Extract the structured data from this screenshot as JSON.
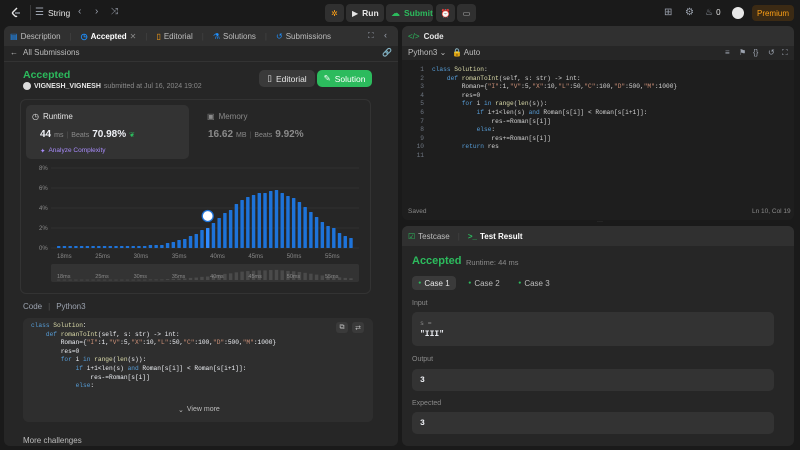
{
  "topbar": {
    "problem_list_label": "String",
    "run_label": "Run",
    "submit_label": "Submit",
    "streak_count": "0",
    "premium_label": "Premium"
  },
  "left_tabs": {
    "description": "Description",
    "accepted": "Accepted",
    "editorial": "Editorial",
    "solutions": "Solutions",
    "submissions": "Submissions"
  },
  "submission": {
    "back_label": "All Submissions",
    "status": "Accepted",
    "user": "VIGNESH_VIGNESH",
    "submitted_text": "submitted at Jul 16, 2024 19:02",
    "editorial_btn": "Editorial",
    "solution_btn": "Solution",
    "runtime_label": "Runtime",
    "runtime_value": "44",
    "runtime_unit": "ms",
    "beats_label": "Beats",
    "runtime_beats": "70.98%",
    "analyze_label": "Analyze Complexity",
    "memory_label": "Memory",
    "memory_value": "16.62",
    "memory_unit": "MB",
    "memory_beats": "9.92%",
    "code_label": "Code",
    "language": "Python3",
    "view_more": "View more",
    "more_challenges": "More challenges"
  },
  "chart_data": {
    "type": "bar",
    "y_ticks": [
      "8%",
      "6%",
      "4%",
      "2%",
      "0%"
    ],
    "ylim": [
      0,
      8
    ],
    "x_ticks": [
      "18ms",
      "25ms",
      "30ms",
      "35ms",
      "40ms",
      "45ms",
      "50ms",
      "55ms"
    ],
    "values": [
      0.2,
      0.2,
      0.2,
      0.2,
      0.2,
      0.2,
      0.2,
      0.2,
      0.2,
      0.2,
      0.2,
      0.2,
      0.2,
      0.2,
      0.2,
      0.2,
      0.3,
      0.3,
      0.3,
      0.5,
      0.6,
      0.8,
      0.9,
      1.2,
      1.4,
      1.8,
      2.0,
      2.5,
      3.0,
      3.5,
      3.8,
      4.4,
      4.8,
      5.1,
      5.3,
      5.5,
      5.5,
      5.7,
      5.8,
      5.5,
      5.2,
      5.0,
      4.6,
      4.1,
      3.6,
      3.1,
      2.6,
      2.2,
      2.0,
      1.5,
      1.2,
      1.0
    ],
    "highlight_index": 26,
    "minimap_ticks": [
      "18ms",
      "25ms",
      "30ms",
      "35ms",
      "40ms",
      "45ms",
      "50ms",
      "55ms"
    ]
  },
  "left_code": [
    [
      [
        "kw",
        "class "
      ],
      [
        "fn",
        "Solution"
      ],
      [
        "",
        "："
      ]
    ],
    [
      [
        "",
        "    "
      ],
      [
        "kw",
        "def "
      ],
      [
        "fn",
        "romanToInt"
      ],
      [
        "",
        "(self, s: str) -> int:"
      ]
    ],
    [
      [
        "",
        "        Roman={"
      ],
      [
        "str",
        "\"I\""
      ],
      [
        "",
        ":1,"
      ],
      [
        "str",
        "\"V\""
      ],
      [
        "",
        ":5,"
      ],
      [
        "str",
        "\"X\""
      ],
      [
        "",
        ":10,"
      ],
      [
        "str",
        "\"L\""
      ],
      [
        "",
        ":50,"
      ],
      [
        "str",
        "\"C\""
      ],
      [
        "",
        ":100,"
      ],
      [
        "str",
        "\"D\""
      ],
      [
        "",
        ":500,"
      ],
      [
        "str",
        "\"M\""
      ],
      [
        "",
        ":1000}"
      ]
    ],
    [
      [
        "",
        "        res=0"
      ]
    ],
    [
      [
        "",
        "        "
      ],
      [
        "kw",
        "for "
      ],
      [
        "",
        "i "
      ],
      [
        "kw",
        "in "
      ],
      [
        "fn",
        "range"
      ],
      [
        "",
        "("
      ],
      [
        "fn",
        "len"
      ],
      [
        "",
        "(s)):"
      ]
    ],
    [
      [
        "",
        "            "
      ],
      [
        "kw",
        "if "
      ],
      [
        "",
        "i+1<len(s) "
      ],
      [
        "kw",
        "and "
      ],
      [
        "",
        "Roman[s[i]] < Roman[s[i+1]]:"
      ]
    ],
    [
      [
        "",
        "                res-=Roman[s[i]]"
      ]
    ],
    [
      [
        "",
        "            "
      ],
      [
        "kw",
        "else"
      ],
      [
        "",
        ":"
      ]
    ]
  ],
  "right_code": {
    "tab_label": "Code",
    "language": "Python3",
    "auto_label": "Auto",
    "saved_label": "Saved",
    "cursor_pos": "Ln 10, Col 19",
    "line_numbers": [
      "1",
      "2",
      "3",
      "4",
      "5",
      "6",
      "7",
      "8",
      "9",
      "10",
      "11"
    ],
    "lines": [
      [
        [
          "kw",
          "class "
        ],
        [
          "fn",
          "Solution"
        ],
        [
          "",
          ":"
        ]
      ],
      [
        [
          "",
          "    "
        ],
        [
          "kw",
          "def "
        ],
        [
          "fn",
          "romanToInt"
        ],
        [
          "",
          "(self, s: str) -> int:"
        ]
      ],
      [
        [
          "",
          "        Roman={"
        ],
        [
          "str",
          "\"I\""
        ],
        [
          "",
          ":1,"
        ],
        [
          "str",
          "\"V\""
        ],
        [
          "",
          ":5,"
        ],
        [
          "str",
          "\"X\""
        ],
        [
          "",
          ":10,"
        ],
        [
          "str",
          "\"L\""
        ],
        [
          "",
          ":50,"
        ],
        [
          "str",
          "\"C\""
        ],
        [
          "",
          ":100,"
        ],
        [
          "str",
          "\"D\""
        ],
        [
          "",
          ":500,"
        ],
        [
          "str",
          "\"M\""
        ],
        [
          "",
          ":1000}"
        ]
      ],
      [
        [
          "",
          "        res=0"
        ]
      ],
      [
        [
          "",
          "        "
        ],
        [
          "kw",
          "for "
        ],
        [
          "",
          "i "
        ],
        [
          "kw",
          "in "
        ],
        [
          "fn",
          "range"
        ],
        [
          "",
          "("
        ],
        [
          "fn",
          "len"
        ],
        [
          "",
          "(s)):"
        ]
      ],
      [
        [
          "",
          "            "
        ],
        [
          "kw",
          "if "
        ],
        [
          "",
          "i+1<len(s) "
        ],
        [
          "kw",
          "and "
        ],
        [
          "",
          "Roman[s[i]] < Roman[s[i+1]]:"
        ]
      ],
      [
        [
          "",
          "                res-=Roman[s[i]]"
        ]
      ],
      [
        [
          "",
          "            "
        ],
        [
          "kw",
          "else"
        ],
        [
          "",
          ":"
        ]
      ],
      [
        [
          "",
          "                res+=Roman[s[i]]"
        ]
      ],
      [
        [
          "",
          "        "
        ],
        [
          "kw",
          "return "
        ],
        [
          "",
          "res"
        ]
      ],
      [
        [
          "",
          ""
        ]
      ]
    ]
  },
  "testresult": {
    "testcase_tab": "Testcase",
    "result_tab": "Test Result",
    "status": "Accepted",
    "runtime_text": "Runtime: 44 ms",
    "cases": [
      "Case 1",
      "Case 2",
      "Case 3"
    ],
    "input_label": "Input",
    "input_var": "s =",
    "input_value": "\"III\"",
    "output_label": "Output",
    "output_value": "3",
    "expected_label": "Expected",
    "expected_value": "3"
  },
  "colors": {
    "accent_green": "#2cbb5d",
    "bar_blue": "#1e73d9",
    "premium": "#ffa116"
  }
}
